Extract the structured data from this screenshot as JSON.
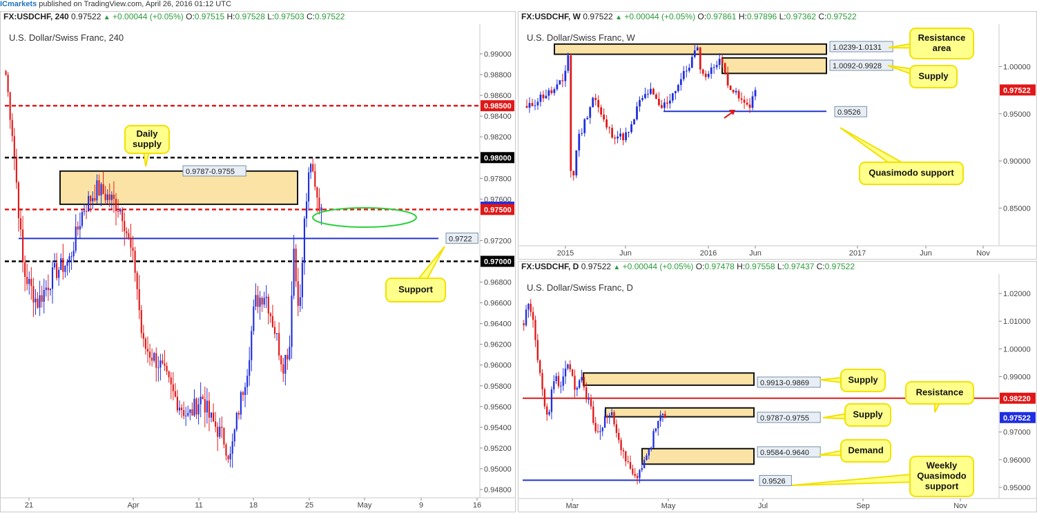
{
  "header": {
    "brand": "ICmarkets",
    "text": "published on TradingView.com, April 26, 2016 01:12 UTC"
  },
  "colors": {
    "up": "#1f2ee0",
    "down": "#e01818",
    "zone_fill": "#fbe3a6",
    "callout_fill": "#ffff8c",
    "callout_border": "#f2e100",
    "support": "#2233cc",
    "ellipse": "#27d13a"
  },
  "panels": {
    "h4": {
      "info": {
        "symbol": "FX:USDCHF, 240",
        "last": "0.97522",
        "change": "+0.00044 (+0.05%)",
        "o_label": "O:",
        "o": "0.97515",
        "h_label": "H:",
        "h": "0.97528",
        "l_label": "L:",
        "l": "0.97503",
        "c_label": "C:",
        "c": "0.97522"
      },
      "title": "U.S. Dollar/Swiss Franc, 240",
      "callouts": {
        "daily_supply": "Daily\nsupply",
        "support": "Support"
      },
      "zone_label": "0.9787-0.9755",
      "level_label": "0.9722"
    },
    "weekly": {
      "info": {
        "symbol": "FX:USDCHF, W",
        "last": "0.97522",
        "change": "+0.00044 (+0.05%)",
        "o_label": "O:",
        "o": "0.97861",
        "h_label": "H:",
        "h": "0.97896",
        "l_label": "L:",
        "l": "0.97362",
        "c_label": "C:",
        "c": "0.97522"
      },
      "title": "U.S. Dollar/Swiss Franc, W",
      "callouts": {
        "resistance_area": "Resistance\narea",
        "supply": "Supply",
        "quasimodo": "Quasimodo support"
      },
      "zone_labels": [
        "1.0239-1.0131",
        "1.0092-0.9928"
      ],
      "level_label": "0.9526"
    },
    "daily": {
      "info": {
        "symbol": "FX:USDCHF, D",
        "last": "0.97522",
        "change": "+0.00044 (+0.05%)",
        "o_label": "O:",
        "o": "0.97478",
        "h_label": "H:",
        "h": "0.97558",
        "l_label": "L:",
        "l": "0.97437",
        "c_label": "C:",
        "c": "0.97522"
      },
      "title": "U.S. Dollar/Swiss Franc, D",
      "callouts": {
        "supply_top": "Supply",
        "resistance": "Resistance",
        "supply_mid": "Supply",
        "demand": "Demand",
        "weekly_qm": "Weekly\nQuasimodo\nsupport"
      },
      "zone_labels": [
        "0.9913-0.9869",
        "0.9787-0.9755",
        "0.9584-0.9640"
      ],
      "level_label": "0.9526"
    }
  },
  "chart_data": [
    {
      "type": "candlestick",
      "title": "U.S. Dollar/Swiss Franc, 240",
      "timeframe": "240",
      "x_ticks": [
        "21",
        "Apr",
        "11",
        "18",
        "25",
        "May",
        "9",
        "16"
      ],
      "y_ticks": [
        "0.99000",
        "0.98800",
        "0.98600",
        "0.98400",
        "0.98200",
        "0.97800",
        "0.97600",
        "0.97200",
        "0.96800",
        "0.96600",
        "0.96400",
        "0.96200",
        "0.96000",
        "0.95800",
        "0.95600",
        "0.95400",
        "0.95200",
        "0.95000",
        "0.94800"
      ],
      "ylim": [
        0.9472,
        0.9914
      ],
      "price_tags": [
        {
          "value": 0.985,
          "label": "0.98500",
          "color": "#e01818"
        },
        {
          "value": 0.98,
          "label": "0.98000",
          "color": "#000000"
        },
        {
          "value": 0.97522,
          "label": "0.97522",
          "color": "#1f2ee0"
        },
        {
          "value": 0.975,
          "label": "0.97500",
          "color": "#e01818"
        },
        {
          "value": 0.97,
          "label": "0.97000",
          "color": "#000000"
        }
      ],
      "lines": [
        {
          "value": 0.985,
          "style": "dashed",
          "color": "#e01818"
        },
        {
          "value": 0.98,
          "style": "dashed",
          "color": "#000000"
        },
        {
          "value": 0.975,
          "style": "dashed",
          "color": "#e01818"
        },
        {
          "value": 0.97,
          "style": "dashed",
          "color": "#000000"
        },
        {
          "value": 0.9722,
          "style": "solid",
          "color": "#2233cc",
          "label": "0.9722"
        }
      ],
      "zones": [
        {
          "from": 0.9755,
          "to": 0.9787,
          "label": "0.9787-0.9755"
        }
      ],
      "annotations": [
        "Daily supply",
        "Support"
      ],
      "close_path": [
        [
          0,
          0.988
        ],
        [
          2,
          0.982
        ],
        [
          5,
          0.969
        ],
        [
          9,
          0.966
        ],
        [
          14,
          0.969
        ],
        [
          18,
          0.97
        ],
        [
          22,
          0.975
        ],
        [
          26,
          0.977
        ],
        [
          30,
          0.976
        ],
        [
          33,
          0.975
        ],
        [
          35,
          0.972
        ],
        [
          37,
          0.969
        ],
        [
          39,
          0.962
        ],
        [
          44,
          0.96
        ],
        [
          48,
          0.957
        ],
        [
          52,
          0.955
        ],
        [
          56,
          0.957
        ],
        [
          58,
          0.955
        ],
        [
          62,
          0.953
        ],
        [
          64,
          0.951
        ],
        [
          66,
          0.955
        ],
        [
          69,
          0.96
        ],
        [
          71,
          0.966
        ],
        [
          74,
          0.967
        ],
        [
          77,
          0.963
        ],
        [
          79,
          0.96
        ],
        [
          81,
          0.962
        ],
        [
          82,
          0.972
        ],
        [
          83,
          0.967
        ],
        [
          84,
          0.966
        ],
        [
          85,
          0.973
        ],
        [
          86,
          0.977
        ],
        [
          87,
          0.979
        ],
        [
          88,
          0.978
        ],
        [
          89,
          0.976
        ],
        [
          90,
          0.9752
        ]
      ]
    },
    {
      "type": "candlestick",
      "title": "U.S. Dollar/Swiss Franc, W",
      "timeframe": "W",
      "x_ticks": [
        "2015",
        "Jun",
        "2016",
        "Jun",
        "2017",
        "Jun",
        "Nov"
      ],
      "y_ticks": [
        "1.00000",
        "0.95000",
        "0.90000",
        "0.85000"
      ],
      "ylim": [
        0.81,
        1.045
      ],
      "price_tags": [
        {
          "value": 0.97522,
          "label": "0.97522",
          "color": "#e01818"
        }
      ],
      "lines": [
        {
          "value": 0.9526,
          "style": "solid",
          "color": "#2233cc",
          "label": "0.9526"
        }
      ],
      "zones": [
        {
          "from": 1.0131,
          "to": 1.0239,
          "label": "1.0239-1.0131"
        },
        {
          "from": 0.9928,
          "to": 1.0092,
          "label": "1.0092-0.9928"
        }
      ],
      "annotations": [
        "Resistance area",
        "Supply",
        "Quasimodo support"
      ],
      "close_path": [
        [
          0,
          0.955
        ],
        [
          5,
          0.968
        ],
        [
          10,
          0.975
        ],
        [
          13,
          0.985
        ],
        [
          15,
          1.015
        ],
        [
          16,
          0.86
        ],
        [
          18,
          0.92
        ],
        [
          20,
          0.935
        ],
        [
          24,
          0.97
        ],
        [
          27,
          0.945
        ],
        [
          30,
          0.93
        ],
        [
          34,
          0.925
        ],
        [
          37,
          0.93
        ],
        [
          40,
          0.96
        ],
        [
          44,
          0.975
        ],
        [
          48,
          0.955
        ],
        [
          51,
          0.965
        ],
        [
          55,
          0.985
        ],
        [
          58,
          1.0
        ],
        [
          61,
          1.02
        ],
        [
          63,
          0.99
        ],
        [
          66,
          0.995
        ],
        [
          69,
          1.01
        ],
        [
          72,
          0.985
        ],
        [
          75,
          0.97
        ],
        [
          78,
          0.96
        ],
        [
          80,
          0.96
        ],
        [
          82,
          0.9752
        ]
      ]
    },
    {
      "type": "candlestick",
      "title": "U.S. Dollar/Swiss Franc, D",
      "timeframe": "D",
      "x_ticks": [
        "Mar",
        "May",
        "Jul",
        "Sep",
        "Nov"
      ],
      "y_ticks": [
        "1.02000",
        "1.01000",
        "1.00000",
        "0.99000",
        "0.97000",
        "0.96000",
        "0.95000"
      ],
      "ylim": [
        0.946,
        1.027
      ],
      "price_tags": [
        {
          "value": 0.9822,
          "label": "0.98220",
          "color": "#e01818"
        },
        {
          "value": 0.97522,
          "label": "0.97522",
          "color": "#1f2ee0"
        }
      ],
      "lines": [
        {
          "value": 0.9822,
          "style": "solid",
          "color": "#e01818"
        },
        {
          "value": 0.9526,
          "style": "solid",
          "color": "#2233cc",
          "label": "0.9526"
        }
      ],
      "zones": [
        {
          "from": 0.9869,
          "to": 0.9913,
          "label": "0.9913-0.9869"
        },
        {
          "from": 0.9755,
          "to": 0.9787,
          "label": "0.9787-0.9755"
        },
        {
          "from": 0.9584,
          "to": 0.964,
          "label": "0.9584-0.9640"
        }
      ],
      "annotations": [
        "Supply",
        "Resistance",
        "Supply",
        "Demand",
        "Weekly Quasimodo support"
      ],
      "close_path": [
        [
          0,
          1.01
        ],
        [
          2,
          1.015
        ],
        [
          4,
          1.01
        ],
        [
          6,
          0.995
        ],
        [
          8,
          0.985
        ],
        [
          10,
          0.975
        ],
        [
          12,
          0.985
        ],
        [
          14,
          0.99
        ],
        [
          16,
          0.985
        ],
        [
          18,
          0.995
        ],
        [
          20,
          0.99
        ],
        [
          22,
          0.985
        ],
        [
          24,
          0.99
        ],
        [
          26,
          0.985
        ],
        [
          28,
          0.98
        ],
        [
          30,
          0.972
        ],
        [
          32,
          0.968
        ],
        [
          34,
          0.975
        ],
        [
          36,
          0.976
        ],
        [
          38,
          0.975
        ],
        [
          40,
          0.97
        ],
        [
          42,
          0.962
        ],
        [
          44,
          0.958
        ],
        [
          46,
          0.955
        ],
        [
          48,
          0.952
        ],
        [
          50,
          0.958
        ],
        [
          52,
          0.962
        ],
        [
          54,
          0.965
        ],
        [
          56,
          0.972
        ],
        [
          58,
          0.975
        ],
        [
          60,
          0.9752
        ]
      ]
    }
  ]
}
